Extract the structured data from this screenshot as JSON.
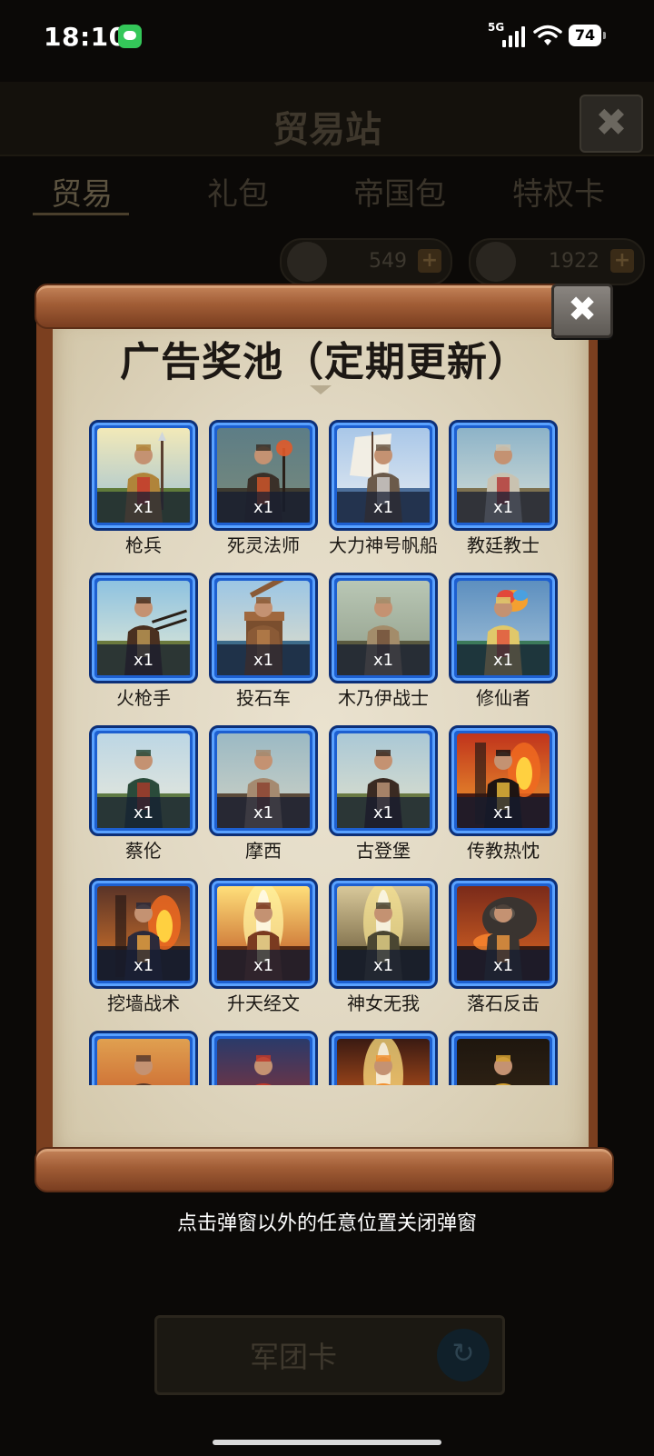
{
  "status_bar": {
    "time": "18:10",
    "network": "5G",
    "battery": "74",
    "icons": [
      "messages-icon",
      "signal-icon",
      "wifi-icon",
      "battery-icon"
    ]
  },
  "background_screen": {
    "title": "贸易站",
    "close_label": "✖",
    "tabs": [
      {
        "label": "贸易",
        "active": true
      },
      {
        "label": "礼包",
        "active": false
      },
      {
        "label": "帝国包",
        "active": false
      },
      {
        "label": "特权卡",
        "active": false
      }
    ],
    "currencies": [
      {
        "icon": "laurel-coin-icon",
        "value": "549",
        "plus": "+"
      },
      {
        "icon": "diamond-icon",
        "value": "1922",
        "plus": "+"
      }
    ],
    "bottom_button_label": "军团卡",
    "refresh_icon": "↻"
  },
  "modal": {
    "title": "广告奖池（定期更新）",
    "close_label": "✖",
    "items": [
      {
        "name": "枪兵",
        "qty": "x1",
        "art": "spearman"
      },
      {
        "name": "死灵法师",
        "qty": "x1",
        "art": "necromancer"
      },
      {
        "name": "大力神号帆船",
        "qty": "x1",
        "art": "sailship"
      },
      {
        "name": "教廷教士",
        "qty": "x1",
        "art": "cleric"
      },
      {
        "name": "火枪手",
        "qty": "x1",
        "art": "musketeer"
      },
      {
        "name": "投石车",
        "qty": "x1",
        "art": "catapult"
      },
      {
        "name": "木乃伊战士",
        "qty": "x1",
        "art": "mummy"
      },
      {
        "name": "修仙者",
        "qty": "x1",
        "art": "immortal"
      },
      {
        "name": "蔡伦",
        "qty": "x1",
        "art": "cai-lun"
      },
      {
        "name": "摩西",
        "qty": "x1",
        "art": "moses"
      },
      {
        "name": "古登堡",
        "qty": "x1",
        "art": "gutenberg"
      },
      {
        "name": "传教热忱",
        "qty": "x1",
        "art": "missionary-zeal"
      },
      {
        "name": "挖墙战术",
        "qty": "x1",
        "art": "wall-digging"
      },
      {
        "name": "升天经文",
        "qty": "x1",
        "art": "ascension-scripture"
      },
      {
        "name": "神女无我",
        "qty": "x1",
        "art": "goddess-selfless"
      },
      {
        "name": "落石反击",
        "qty": "x1",
        "art": "falling-rock"
      },
      {
        "name": "",
        "qty": "",
        "art": "robot-tree"
      },
      {
        "name": "",
        "qty": "",
        "art": "shield"
      },
      {
        "name": "",
        "qty": "",
        "art": "fire-gate"
      },
      {
        "name": "",
        "qty": "",
        "art": "golden-armor"
      }
    ]
  },
  "dismiss_hint": "点击弹窗以外的任意位置关闭弹窗",
  "colors": {
    "frame_blue": "#1d5fd0",
    "frame_border": "#0c2f78",
    "scroll_wood": "#a15d36",
    "paper": "#e6dec8",
    "overlay_dark": "#0b0907"
  }
}
